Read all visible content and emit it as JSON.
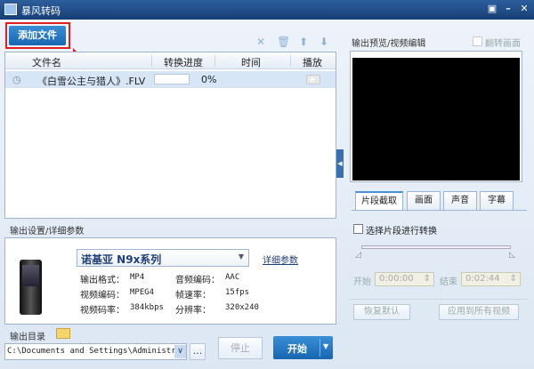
{
  "window": {
    "title": "暴风转码",
    "restore": "▣",
    "minimize": "–",
    "close": "✕"
  },
  "toolbar": {
    "add_file": "添加文件",
    "icons": [
      "close-icon",
      "trash-icon",
      "arrow-up-icon",
      "arrow-down-icon"
    ]
  },
  "list": {
    "columns": [
      "文件名",
      "转换进度",
      "时间",
      "播放"
    ],
    "rows": [
      {
        "name": "《白雪公主与猎人》.FLV",
        "progress_percent": 0,
        "progress_text": "0%",
        "time": ""
      }
    ]
  },
  "output": {
    "section_label": "输出设置/详细参数",
    "preset": "诺基亚 N9x系列",
    "details_link": "详细参数",
    "params": [
      {
        "k": "输出格式：",
        "v": "MP4"
      },
      {
        "k": "音频编码：",
        "v": "AAC"
      },
      {
        "k": "视频编码：",
        "v": "MPEG4"
      },
      {
        "k": "帧速率：",
        "v": "15fps"
      },
      {
        "k": "视频码率：",
        "v": "384kbps"
      },
      {
        "k": "分辨率：",
        "v": "320x240"
      }
    ],
    "dir_label": "输出目录",
    "path": "C:\\Documents and Settings\\Administra",
    "browse": "...",
    "stop": "停止",
    "start": "开始"
  },
  "preview": {
    "label": "输出预览/视频编辑",
    "flip": "翻转画面",
    "tabs": [
      "片段截取",
      "画面",
      "声音",
      "字幕"
    ],
    "segment_checkbox": "选择片段进行转换",
    "start_label": "开始",
    "start_time": "0:00:00",
    "end_label": "结束",
    "end_time": "0:02:44",
    "reset": "恢复默认",
    "apply_all": "应用到所有视频"
  }
}
